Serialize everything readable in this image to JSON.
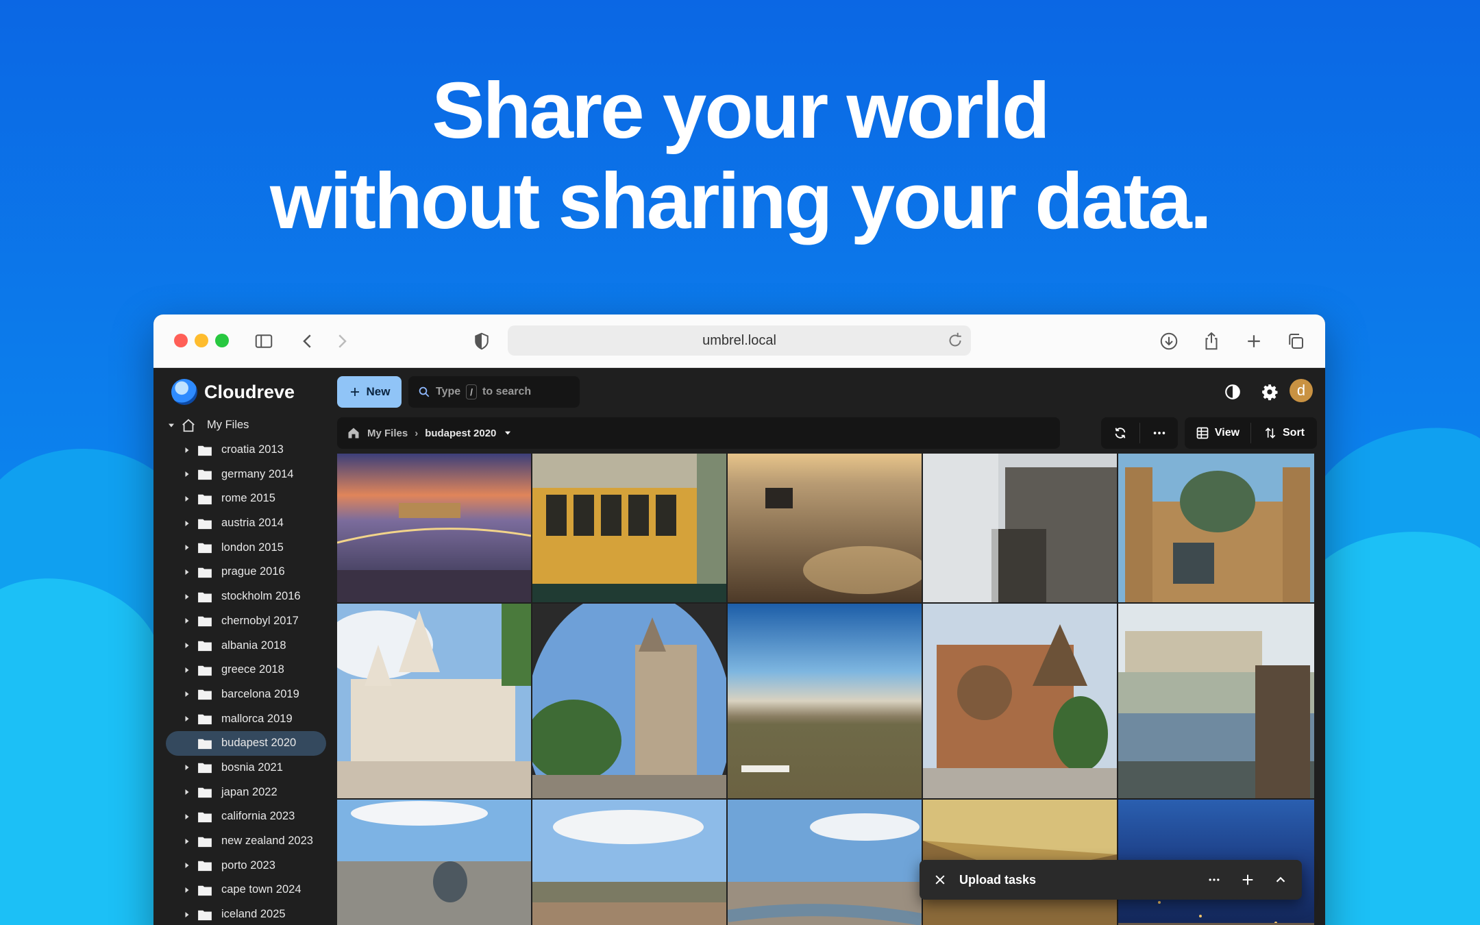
{
  "headline": {
    "line1": "Share your world",
    "line2": "without sharing your data."
  },
  "browser": {
    "url": "umbrel.local",
    "icons": [
      "sidebar-toggle-icon",
      "back-icon",
      "forward-icon",
      "shield-icon",
      "reload-icon",
      "download-icon",
      "share-icon",
      "new-tab-icon",
      "tabs-icon"
    ]
  },
  "app": {
    "name": "Cloudreve",
    "new_label": "New",
    "search": {
      "prefix": "Type",
      "key": "/",
      "suffix": "to search"
    },
    "avatar_letter": "d",
    "breadcrumb": {
      "root": "My Files",
      "current": "budapest 2020"
    },
    "toolbar": {
      "view_label": "View",
      "sort_label": "Sort"
    },
    "tree": {
      "root": "My Files",
      "folders": [
        "croatia 2013",
        "germany 2014",
        "rome 2015",
        "austria 2014",
        "london 2015",
        "prague 2016",
        "stockholm 2016",
        "chernobyl 2017",
        "albania 2018",
        "greece 2018",
        "barcelona 2019",
        "mallorca 2019",
        "budapest 2020",
        "bosnia 2021",
        "japan 2022",
        "california 2023",
        "new zealand 2023",
        "porto 2023",
        "cape town 2024",
        "iceland 2025"
      ],
      "active": "budapest 2020"
    },
    "upload": {
      "label": "Upload tasks"
    }
  },
  "colors": {
    "background_top": "#0a6fe6",
    "cloud": "#1ec0f5",
    "app_bg": "#1f1f1f",
    "accent_button": "#90c4f7",
    "active_row": "#34495e"
  }
}
